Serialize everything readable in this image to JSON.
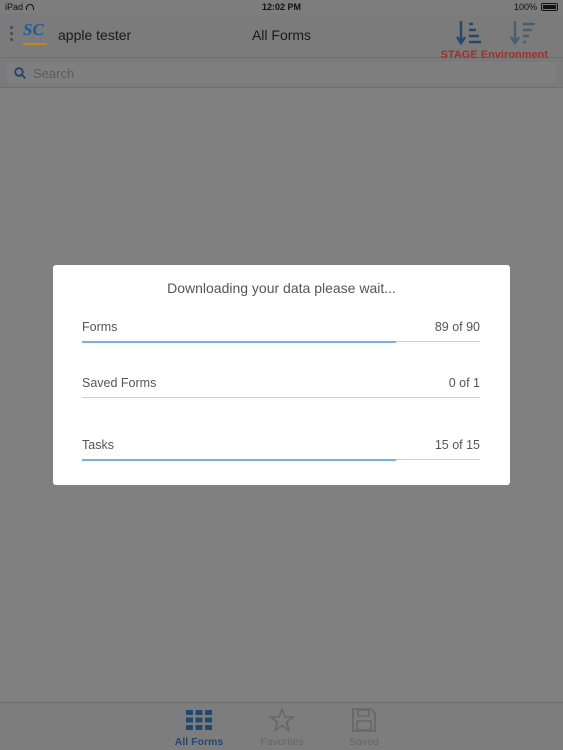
{
  "status_bar": {
    "device": "iPad",
    "time": "12:02 PM",
    "battery": "100%"
  },
  "header": {
    "user_name": "apple tester",
    "title": "All Forms",
    "logo_text": "SC",
    "environment": "STAGE Environment"
  },
  "search": {
    "placeholder": "Search"
  },
  "modal": {
    "title": "Downloading your data please wait...",
    "rows": [
      {
        "label": "Forms",
        "count": "89 of 90",
        "progress": 0.79
      },
      {
        "label": "Saved Forms",
        "count": "0 of 1",
        "progress": 0
      },
      {
        "label": "Tasks",
        "count": "15 of 15",
        "progress": 0.79
      }
    ]
  },
  "tabs": [
    {
      "label": "All Forms",
      "icon": "grid-icon",
      "active": true
    },
    {
      "label": "Favorites",
      "icon": "star-icon",
      "active": false
    },
    {
      "label": "Saved",
      "icon": "floppy-disk-icon",
      "active": false
    }
  ],
  "colors": {
    "accent": "#244770",
    "progress": "#7aaedc",
    "environment": "#a0302a"
  }
}
